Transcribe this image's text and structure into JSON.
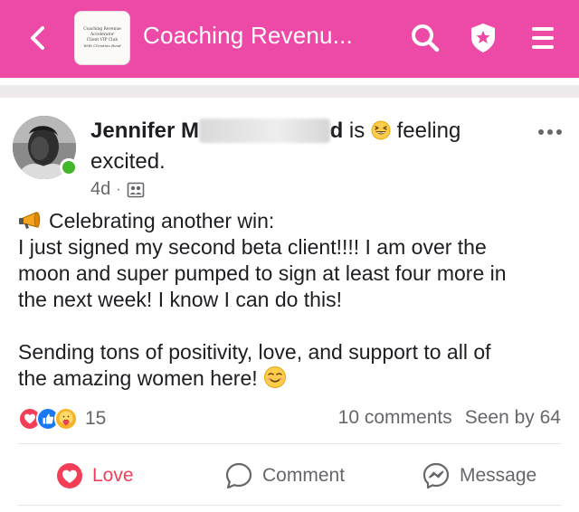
{
  "colors": {
    "top_bar": "#ec4aa6",
    "love": "#f33e58",
    "like": "#1877f2",
    "care": "#f7b125",
    "online": "#42b72a",
    "secondary_text": "#65676b"
  },
  "top_bar": {
    "back_icon": "chevron-left-icon",
    "group_thumbnail_lines": [
      "Coaching Revenue",
      "Accelerator",
      "Client VIP Club",
      "With Christine Bond"
    ],
    "title": "Coaching Revenu...",
    "icons": [
      "search-icon",
      "shield-star-icon",
      "hamburger-menu-icon"
    ]
  },
  "post": {
    "author_visible": "Jennifer M",
    "author_hidden_end": "d",
    "status_is": "is",
    "feeling_word": "feeling",
    "feeling": "excited.",
    "feeling_emoji": "grinning-squinting-face",
    "time": "4d",
    "audience_icon": "group-members-icon",
    "more_icon": "more-horizontal-icon",
    "body": {
      "line1_emoji": "megaphone",
      "line1": "Celebrating another win:",
      "line2": "I just signed my second beta client!!!! I am over the",
      "line3": "moon and super pumped to sign at least four more in",
      "line4": "the next week! I know I can do this!",
      "line5": "Sending tons of positivity, love, and support to all of",
      "line6": "the amazing women here!",
      "line6_emoji": "smiling-face"
    },
    "reactions": {
      "types": [
        "love",
        "like",
        "care"
      ],
      "count": "15"
    },
    "comments": "10 comments",
    "seen_by": "Seen by 64"
  },
  "actions": {
    "love": "Love",
    "comment": "Comment",
    "message": "Message"
  }
}
